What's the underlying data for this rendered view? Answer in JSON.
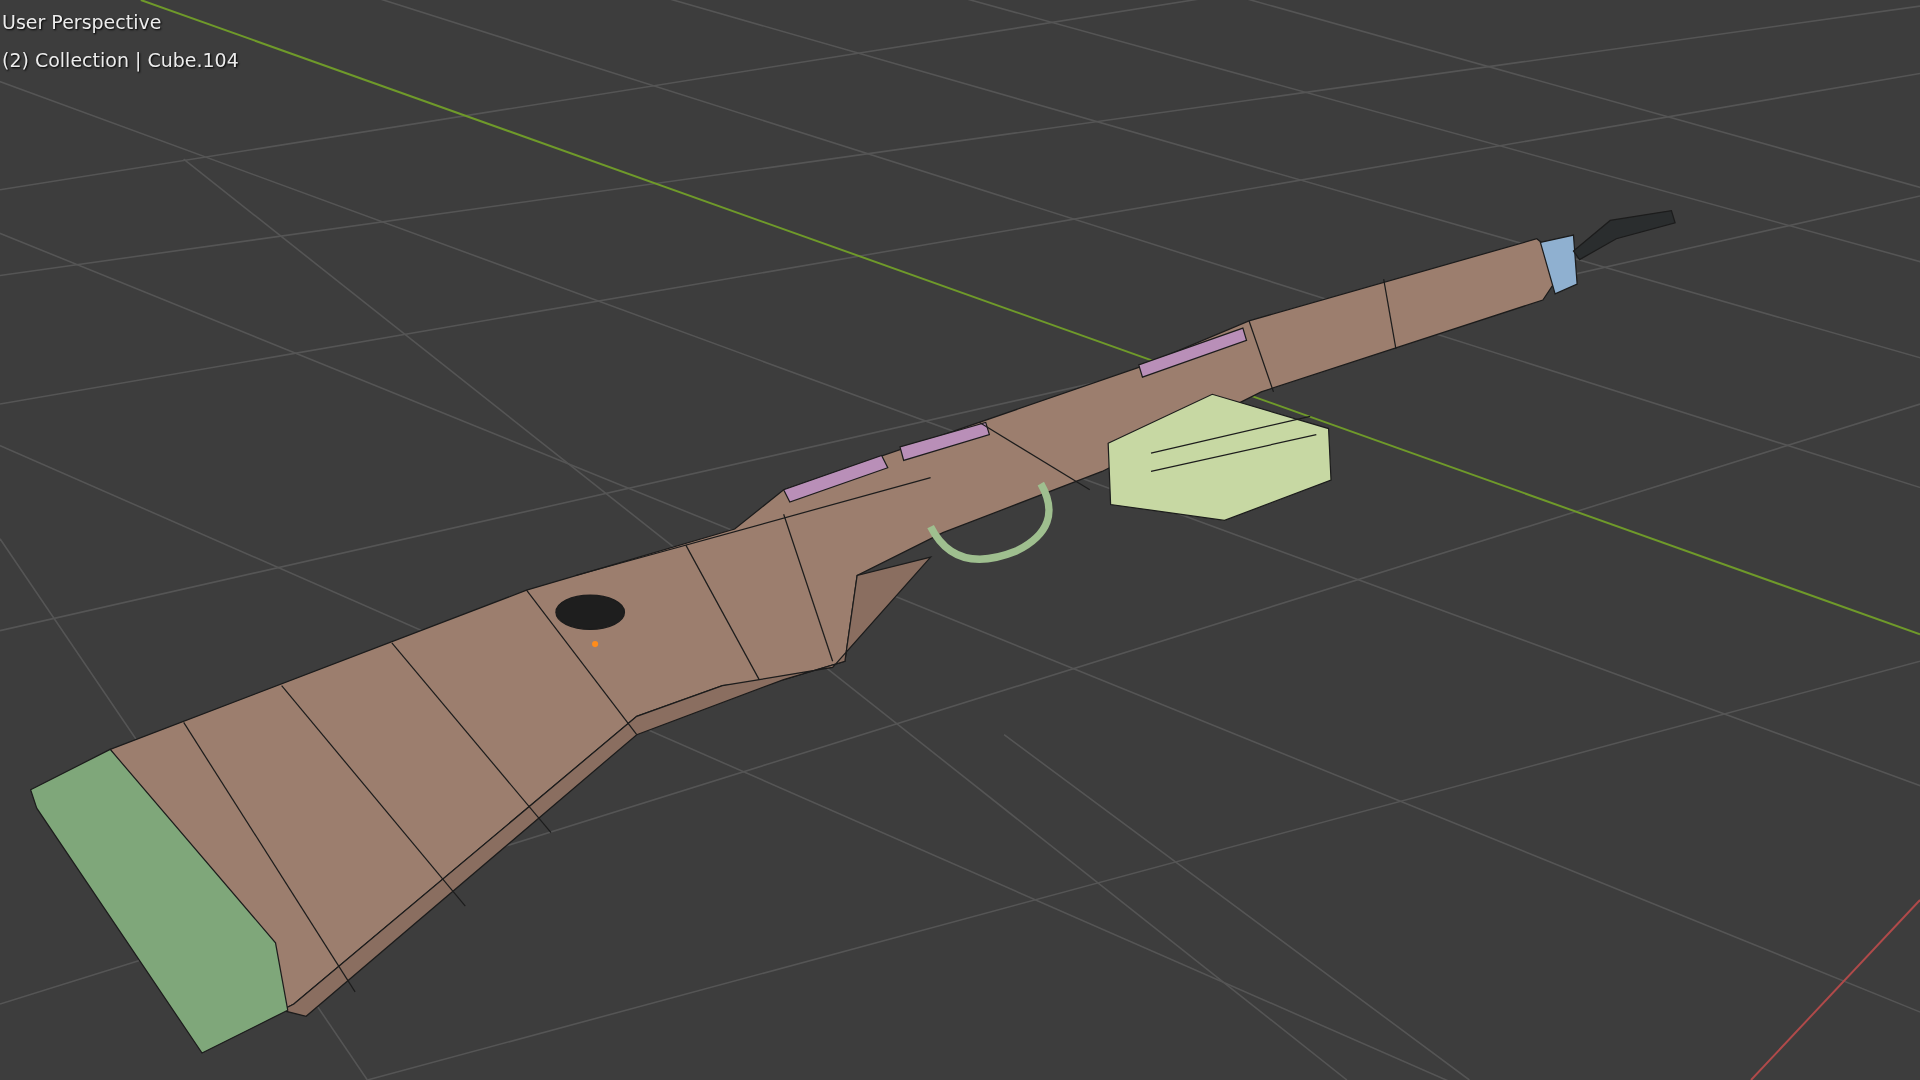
{
  "viewport": {
    "view_name": "User Perspective",
    "object_info": "(2) Collection | Cube.104"
  }
}
